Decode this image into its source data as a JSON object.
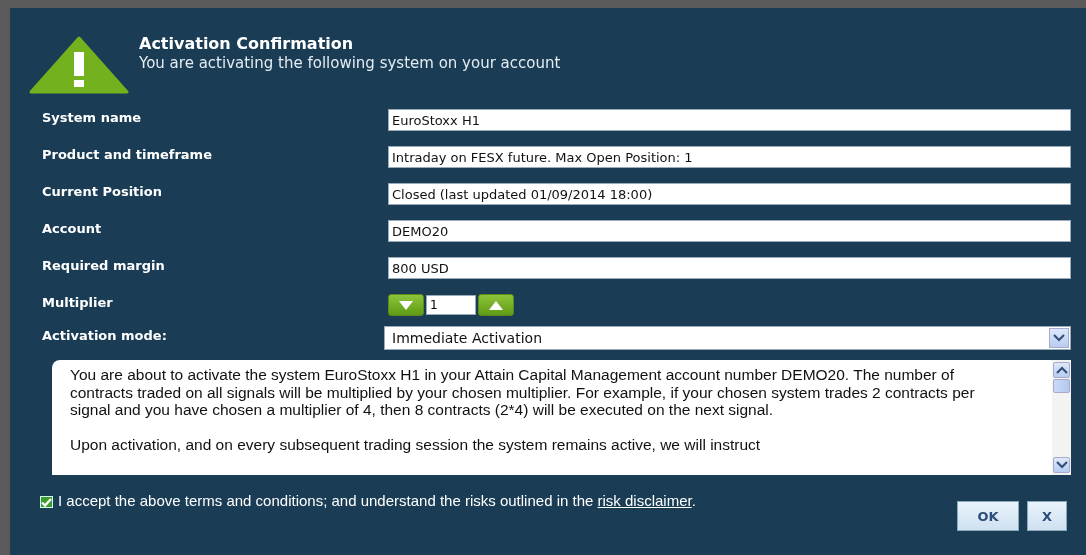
{
  "header": {
    "title": "Activation Confirmation",
    "subtitle": "You are activating the following system on your account"
  },
  "fields": [
    {
      "label": "System name",
      "value": "EuroStoxx H1"
    },
    {
      "label": "Product and timeframe",
      "value": "Intraday on FESX future. Max Open Position: 1"
    },
    {
      "label": "Current Position",
      "value": "Closed (last updated 01/09/2014 18:00)"
    },
    {
      "label": "Account",
      "value": "DEMO20"
    },
    {
      "label": "Required margin",
      "value": "800 USD"
    }
  ],
  "multiplier": {
    "label": "Multiplier",
    "value": "1"
  },
  "activation_mode": {
    "label": "Activation mode:",
    "value": "Immediate Activation"
  },
  "terms": {
    "paragraphs": [
      "You are about to activate the system EuroStoxx H1 in your Attain Capital Management account number DEMO20. The number of contracts traded on all signals will be multiplied by your chosen multiplier. For example, if your chosen system trades 2 contracts per signal and you have chosen a multiplier of 4, then 8 contracts (2*4) will be executed on the next signal.",
      "Upon activation, and on every subsequent trading session the system remains active, we will instruct"
    ]
  },
  "accept": {
    "checked": true,
    "text": "I accept the above terms and conditions; and understand the risks outlined in the",
    "link": "risk disclaimer",
    "after": "."
  },
  "buttons": [
    {
      "kind": "ok",
      "label": "OK"
    },
    {
      "kind": "cancel",
      "label": "X"
    }
  ]
}
